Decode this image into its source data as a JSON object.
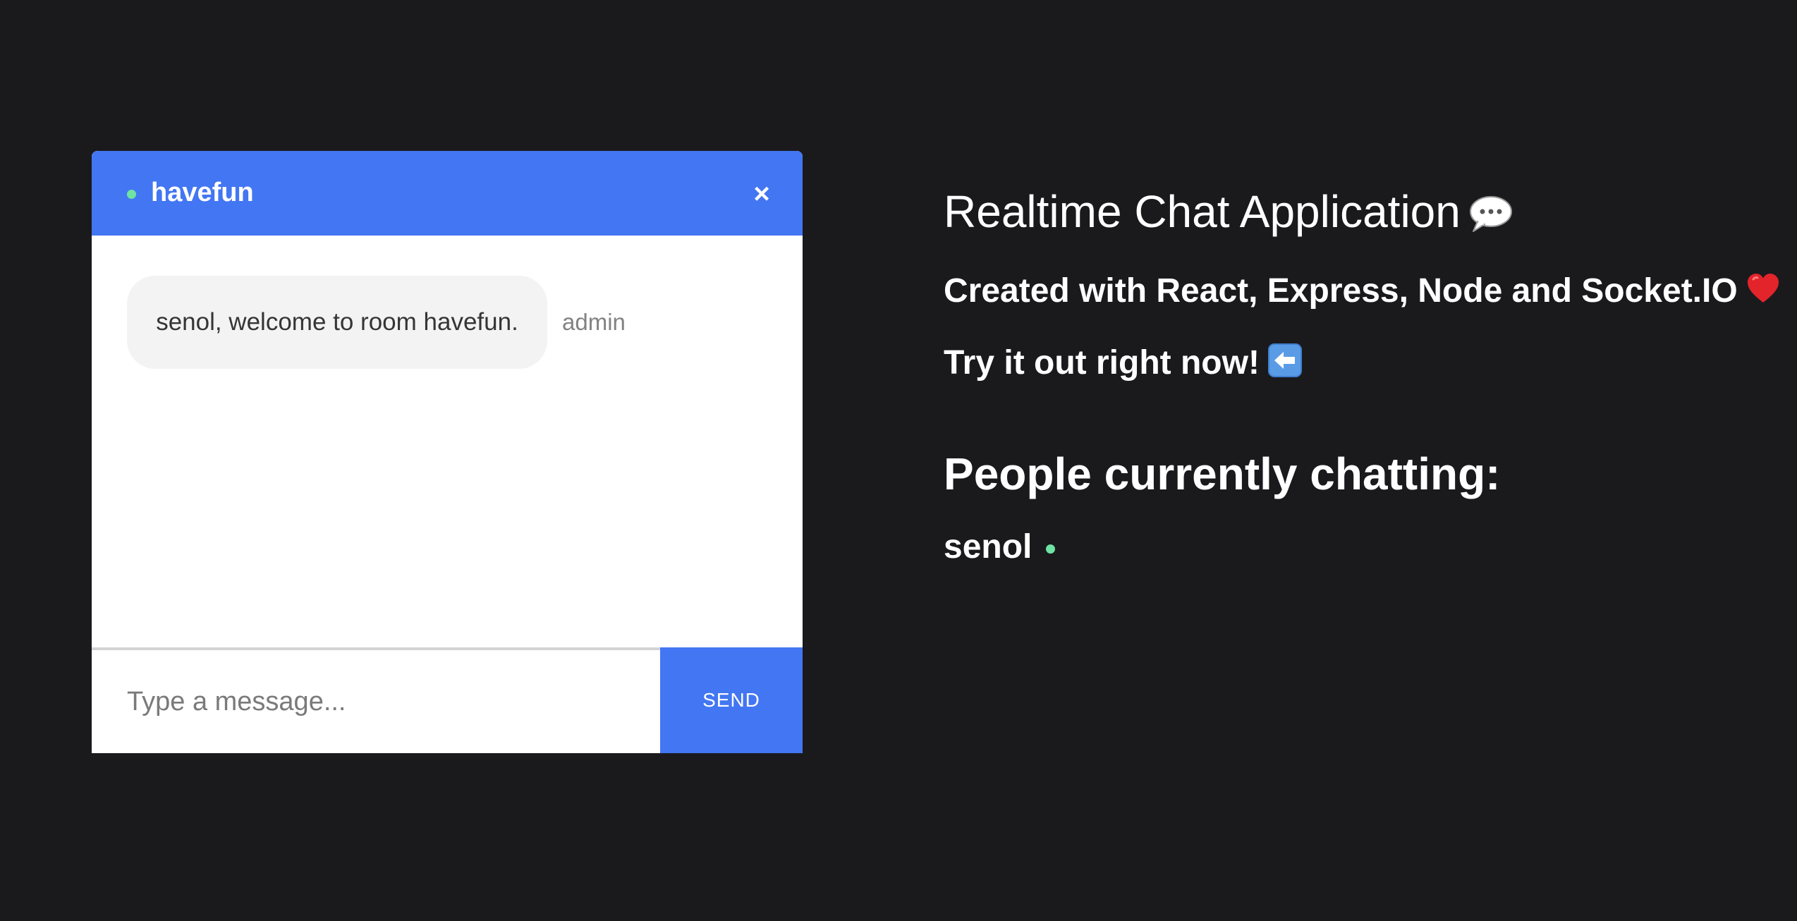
{
  "chat": {
    "room_name": "havefun",
    "close_label": "×",
    "messages": [
      {
        "text": "senol, welcome to room havefun.",
        "sender": "admin"
      }
    ],
    "composer": {
      "placeholder": "Type a message...",
      "value": "",
      "send_label": "SEND"
    }
  },
  "info": {
    "title": "Realtime Chat Application",
    "title_icon": "speech-bubble-icon",
    "subtitle": "Created with React, Express, Node and Socket.IO",
    "subtitle_icon": "heart-icon",
    "cta": "Try it out right now!",
    "cta_icon": "left-arrow-icon",
    "people_heading": "People currently chatting:",
    "people": [
      {
        "name": "senol",
        "status": "online"
      }
    ]
  },
  "colors": {
    "background": "#1a1a1d",
    "accent": "#4376f2",
    "online": "#6fe3a3",
    "bubble": "#f3f3f3"
  }
}
